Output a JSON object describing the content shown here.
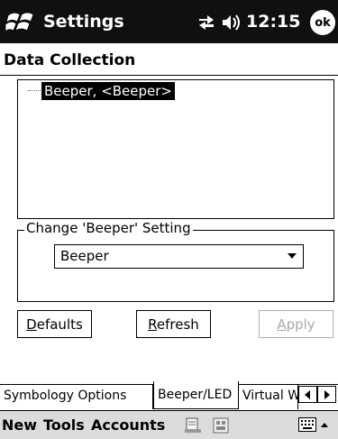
{
  "titlebar": {
    "app_title": "Settings",
    "clock": "12:15",
    "ok_label": "ok"
  },
  "page": {
    "title": "Data Collection"
  },
  "tree": {
    "items": [
      {
        "label": "Beeper, <Beeper>",
        "selected": true
      }
    ]
  },
  "setting_group": {
    "label": "Change 'Beeper' Setting",
    "dropdown_value": "Beeper"
  },
  "buttons": {
    "defaults": "Defaults",
    "refresh": "Refresh",
    "apply": "Apply",
    "apply_enabled": false
  },
  "tabs": [
    {
      "label": "Symbology Options",
      "active": false
    },
    {
      "label": "Beeper/LED",
      "active": true
    },
    {
      "label": "Virtual W",
      "active": false
    }
  ],
  "menubar": {
    "items": [
      "New",
      "Tools",
      "Accounts"
    ]
  },
  "icons": {
    "start": "windows-flag-icon",
    "connectivity": "connectivity-icon",
    "volume": "speaker-icon",
    "toolbar_1": "toolbar-icon",
    "toolbar_2": "toolbar-icon",
    "keyboard": "keyboard-icon"
  },
  "colors": {
    "titlebar_bg": "#101010",
    "menubar_bg": "#dcdcdc",
    "selection_bg": "#000000",
    "disabled_text": "#a8a8a8"
  }
}
